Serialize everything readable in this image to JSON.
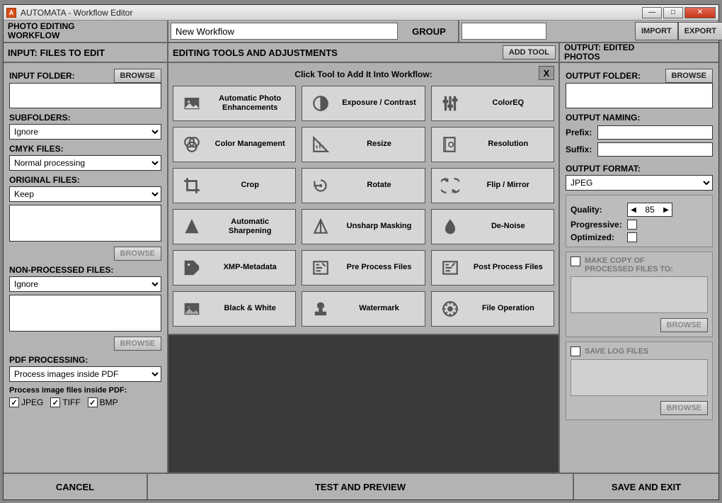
{
  "titlebar": {
    "title": "AUTOMATA - Workflow Editor"
  },
  "header": {
    "workflow_title_l1": "PHOTO EDITING",
    "workflow_title_l2": "WORKFLOW",
    "name_value": "New Workflow",
    "group_label": "GROUP",
    "group_value": "",
    "import": "IMPORT",
    "export": "EXPORT"
  },
  "sections": {
    "input": "INPUT: FILES TO EDIT",
    "tools": "EDITING TOOLS AND ADJUSTMENTS",
    "add_tool": "ADD TOOL",
    "output_l1": "OUTPUT: EDITED",
    "output_l2": "PHOTOS"
  },
  "left": {
    "input_folder": "INPUT FOLDER:",
    "browse": "BROWSE",
    "subfolders": "SUBFOLDERS:",
    "subfolders_val": "Ignore",
    "cmyk": "CMYK FILES:",
    "cmyk_val": "Normal  processing",
    "original": "ORIGINAL FILES:",
    "original_val": "Keep",
    "nonproc": "NON-PROCESSED FILES:",
    "nonproc_val": "Ignore",
    "pdf_proc": "PDF PROCESSING:",
    "pdf_proc_val": "Process images inside PDF",
    "pdf_inside": "Process image files inside PDF:",
    "jpeg": "JPEG",
    "tiff": "TIFF",
    "bmp": "BMP"
  },
  "tools_panel": {
    "header": "Click Tool to Add It Into Workflow:",
    "close": "X",
    "items": [
      "Automatic Photo Enhancements",
      "Exposure / Contrast",
      "ColorEQ",
      "Color Management",
      "Resize",
      "Resolution",
      "Crop",
      "Rotate",
      "Flip / Mirror",
      "Automatic Sharpening",
      "Unsharp Masking",
      "De-Noise",
      "XMP-Metadata",
      "Pre Process Files",
      "Post Process Files",
      "Black & White",
      "Watermark",
      "File Operation"
    ]
  },
  "right": {
    "output_folder": "OUTPUT FOLDER:",
    "browse": "BROWSE",
    "output_naming": "OUTPUT NAMING:",
    "prefix": "Prefix:",
    "suffix": "Suffix:",
    "output_format": "OUTPUT FORMAT:",
    "format_val": "JPEG",
    "quality": "Quality:",
    "quality_val": "85",
    "progressive": "Progressive:",
    "optimized": "Optimized:",
    "make_copy_l1": "MAKE COPY OF",
    "make_copy_l2": "PROCESSED FILES TO:",
    "save_log": "SAVE LOG FILES"
  },
  "footer": {
    "cancel": "CANCEL",
    "test": "TEST AND PREVIEW",
    "save": "SAVE AND EXIT"
  }
}
